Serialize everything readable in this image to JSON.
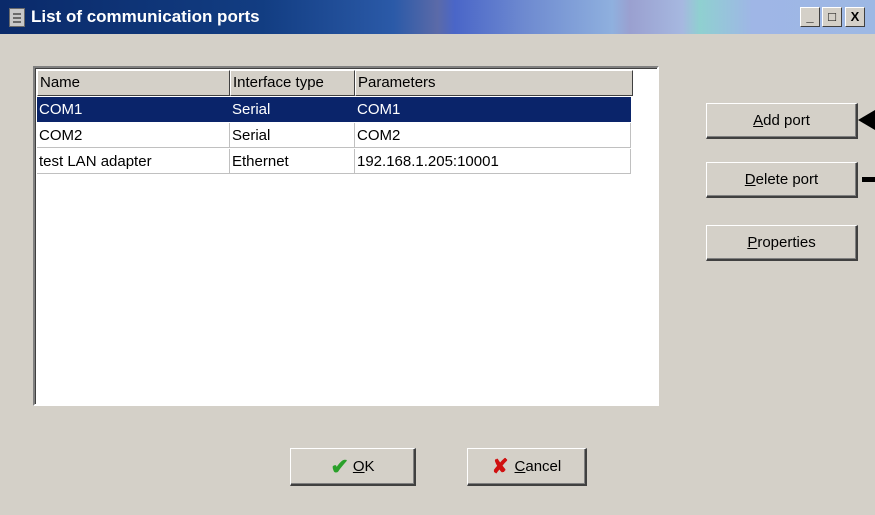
{
  "window": {
    "title": "List of communication ports",
    "controls": {
      "minimize": "_",
      "maximize": "□",
      "close": "X"
    }
  },
  "ports_table": {
    "columns": [
      "Name",
      "Interface type",
      "Parameters"
    ],
    "rows": [
      {
        "name": "COM1",
        "interface_type": "Serial",
        "parameters": "COM1",
        "selected": true
      },
      {
        "name": "COM2",
        "interface_type": "Serial",
        "parameters": "COM2",
        "selected": false
      },
      {
        "name": "test LAN adapter",
        "interface_type": "Ethernet",
        "parameters": "192.168.1.205:10001",
        "selected": false
      }
    ]
  },
  "buttons": {
    "add_port": {
      "mnemonic": "A",
      "rest": "dd port"
    },
    "delete_port": {
      "mnemonic": "D",
      "rest": "elete port"
    },
    "properties": {
      "mnemonic": "P",
      "rest": "roperties"
    },
    "ok": {
      "mnemonic": "O",
      "rest": "K"
    },
    "cancel": {
      "mnemonic": "C",
      "rest": "ancel"
    }
  },
  "icons": {
    "ok": "check-icon",
    "cancel": "x-icon",
    "window": "document-icon"
  },
  "colors": {
    "selection": "#0a246a",
    "ok_check": "#2aa02a",
    "cancel_x": "#d01010"
  }
}
